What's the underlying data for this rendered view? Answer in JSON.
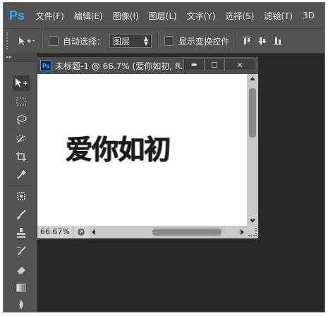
{
  "app": {
    "logo": "Ps"
  },
  "menu": {
    "items": [
      "文件(F)",
      "编辑(E)",
      "图像(I)",
      "图层(L)",
      "文字(Y)",
      "选择(S)",
      "滤镜(T)",
      "3D"
    ]
  },
  "options": {
    "auto_select_label": "自动选择：",
    "auto_select_value": "图层",
    "show_transform_label": "显示变换控件"
  },
  "toolpanel": {
    "collapse_label": "▸▸"
  },
  "document": {
    "tab_icon": "Ps",
    "title": "未标题-1 @ 66.7% (爱你如初, R...",
    "artwork_text": "爱你如初",
    "zoom": "66.67%"
  },
  "window_buttons": {
    "minimize": "▬",
    "restore": "☐",
    "close": "✕"
  },
  "icons": [
    "move-tool",
    "marquee",
    "lasso",
    "quick-select",
    "crop",
    "eyedropper",
    "spot-heal",
    "brush",
    "stamp",
    "history-brush",
    "eraser",
    "gradient",
    "blur"
  ],
  "colors": {
    "ps_blue": "#30a8ff",
    "menu_bg": "#535353",
    "workspace": "#282828"
  }
}
